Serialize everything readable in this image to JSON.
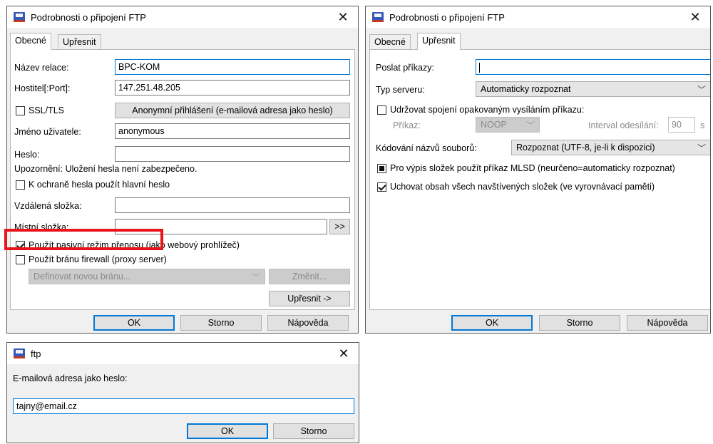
{
  "dialog_general": {
    "title": "Podrobnosti o připojení FTP",
    "tabs": [
      {
        "label": "Obecné"
      },
      {
        "label": "Upřesnit"
      }
    ],
    "session_name_label": "Název relace:",
    "session_name_value": "BPC-KOM",
    "host_label": "Hostitel[:Port]:",
    "host_value": "147.251.48.205",
    "ssl_label": "SSL/TLS",
    "anonymous_button": "Anonymní přihlášení (e-mailová adresa jako heslo)",
    "username_label": "Jméno uživatele:",
    "username_value": "anonymous",
    "password_label": "Heslo:",
    "password_value": "",
    "warning_text": "Upozornění: Uložení hesla není zabezpečeno.",
    "master_password_label": "K ochraně hesla použít hlavní heslo",
    "remote_folder_label": "Vzdálená složka:",
    "remote_folder_value": "",
    "local_folder_label": "Místní složka:",
    "local_folder_value": "",
    "browse_button": ">>",
    "passive_mode_label": "Použít pasivní režim přenosu (jako webový prohlížeč)",
    "firewall_label": "Použít bránu firewall (proxy server)",
    "proxy_select_value": "Definovat novou bránu...",
    "change_button": "Změnit...",
    "advanced_button": "Upřesnit ->",
    "ok_button": "OK",
    "cancel_button": "Storno",
    "help_button": "Nápověda"
  },
  "dialog_advanced": {
    "title": "Podrobnosti o připojení FTP",
    "tabs": [
      {
        "label": "Obecné"
      },
      {
        "label": "Upřesnit"
      }
    ],
    "send_commands_label": "Poslat příkazy:",
    "send_commands_value": "",
    "server_type_label": "Typ serveru:",
    "server_type_value": "Automaticky rozpoznat",
    "keepalive_label": "Udržovat spojení opakovaným vysíláním příkazu:",
    "command_label": "Příkaz:",
    "command_value": "NOOP",
    "interval_label": "Interval odesílání:",
    "interval_value": "90",
    "interval_unit": "s",
    "encoding_label": "Kódování názvů souborů:",
    "encoding_value": "Rozpoznat (UTF-8, je-li k dispozici)",
    "mlsd_label": "Pro výpis složek použít příkaz MLSD (neurčeno=automaticky rozpoznat)",
    "cache_label": "Uchovat obsah všech navštívených složek (ve vyrovnávací paměti)",
    "ok_button": "OK",
    "cancel_button": "Storno",
    "help_button": "Nápověda"
  },
  "dialog_ftp": {
    "title": "ftp",
    "email_label": "E-mailová adresa jako heslo:",
    "email_value": "tajny@email.cz",
    "ok_button": "OK",
    "cancel_button": "Storno"
  },
  "colors": {
    "highlight": "#e8141b",
    "focus": "#0078d7",
    "dialog_bg": "#f0f0f0"
  },
  "icons": {
    "app": "ftp-app-icon",
    "close": "close-icon"
  }
}
